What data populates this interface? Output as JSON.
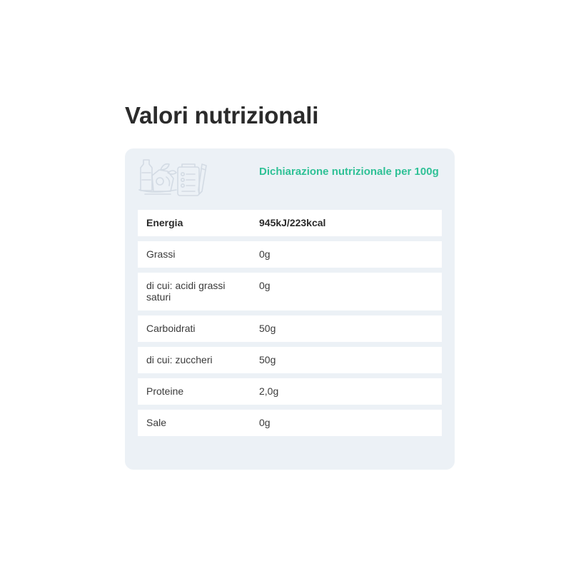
{
  "page": {
    "title": "Valori nutrizionali"
  },
  "panel": {
    "header_label": "Dichiarazione nutrizionale per 100g",
    "illustration_icon": "grocery-and-receipt-icon",
    "colors": {
      "accent": "#2fc196",
      "panel_background": "#ecf1f6",
      "row_background": "#ffffff"
    }
  },
  "nutrition": {
    "rows": [
      {
        "name": "Energia",
        "value": "945kJ/223kcal",
        "bold": true
      },
      {
        "name": "Grassi",
        "value": "0g",
        "bold": false
      },
      {
        "name": "di cui: acidi grassi saturi",
        "value": "0g",
        "bold": false
      },
      {
        "name": "Carboidrati",
        "value": "50g",
        "bold": false
      },
      {
        "name": "di cui: zuccheri",
        "value": "50g",
        "bold": false
      },
      {
        "name": "Proteine",
        "value": "2,0g",
        "bold": false
      },
      {
        "name": "Sale",
        "value": "0g",
        "bold": false
      }
    ]
  }
}
